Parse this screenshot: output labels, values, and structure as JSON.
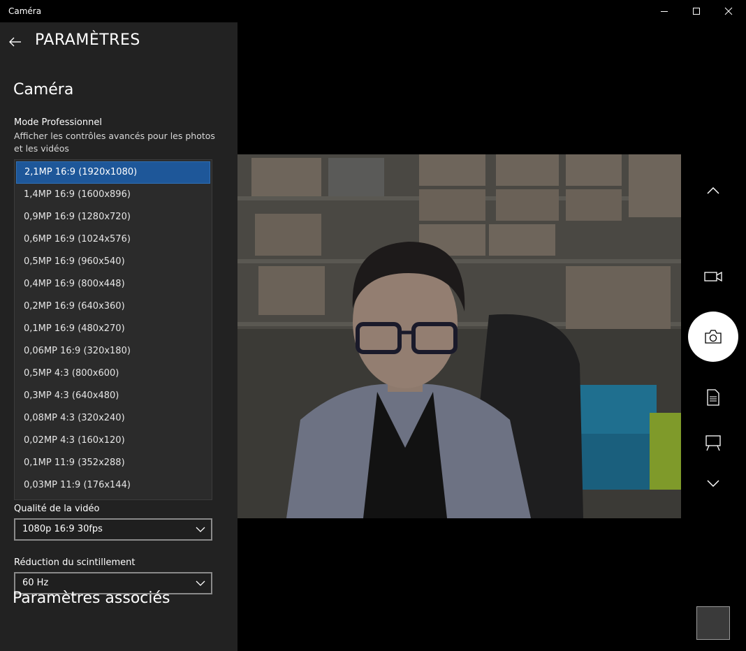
{
  "window": {
    "title": "Caméra"
  },
  "settings": {
    "header_title": "PARAMÈTRES",
    "section_title": "Caméra",
    "pro_mode_label": "Mode Professionnel",
    "pro_mode_desc": "Afficher les contrôles avancés pour les photos et les vidéos",
    "photo_resolution_options": [
      "2,1MP 16:9 (1920x1080)",
      "1,4MP 16:9 (1600x896)",
      "0,9MP 16:9 (1280x720)",
      "0,6MP 16:9 (1024x576)",
      "0,5MP 16:9 (960x540)",
      "0,4MP 16:9 (800x448)",
      "0,2MP 16:9 (640x360)",
      "0,1MP 16:9 (480x270)",
      "0,06MP 16:9 (320x180)",
      "0,5MP 4:3 (800x600)",
      "0,3MP 4:3 (640x480)",
      "0,08MP 4:3 (320x240)",
      "0,02MP 4:3 (160x120)",
      "0,1MP 11:9 (352x288)",
      "0,03MP 11:9 (176x144)"
    ],
    "photo_resolution_selected_index": 0,
    "video_quality_label": "Qualité de la vidéo",
    "video_quality_value": "1080p 16:9 30fps",
    "flicker_label": "Réduction du scintillement",
    "flicker_value": "60 Hz",
    "related_title": "Paramètres associés"
  },
  "controls": {
    "icons": [
      "chevron-up-icon",
      "video-camera-icon",
      "photo-camera-icon",
      "document-scan-icon",
      "whiteboard-icon",
      "chevron-down-icon"
    ]
  },
  "colors": {
    "panel_bg": "#222222",
    "selected_bg": "#1e5799",
    "background": "#000000"
  }
}
